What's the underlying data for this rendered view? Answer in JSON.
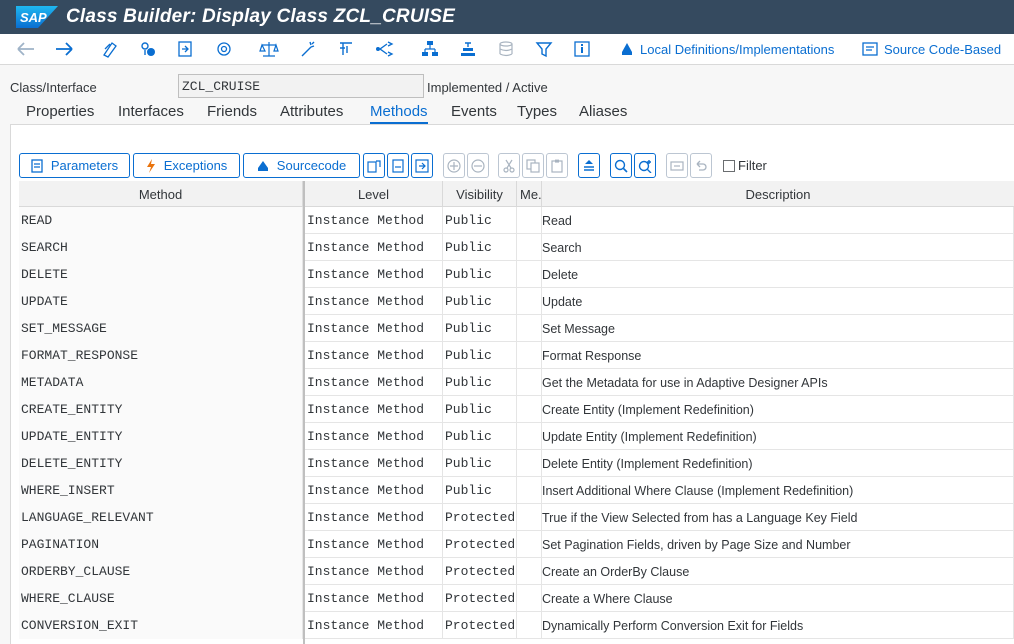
{
  "window": {
    "title": "Class Builder: Display Class ZCL_CRUISE",
    "logo": "SAP"
  },
  "toolbar": {
    "icons": [
      "back-icon",
      "forward-icon",
      "change-display-icon",
      "active-inactive-icon",
      "other-object-icon",
      "where-used-icon",
      "check-icon",
      "activate-icon",
      "test-icon",
      "outline-icon",
      "navigate-icon",
      "hierarchy-icon",
      "pattern-icon",
      "enhance-icon",
      "filter-icon",
      "info-icon"
    ],
    "local_defs_label": "Local Definitions/Implementations",
    "source_code_label": "Source Code-Based"
  },
  "header": {
    "class_label": "Class/Interface",
    "class_value": "ZCL_CRUISE",
    "status": "Implemented / Active"
  },
  "tabs": [
    "Properties",
    "Interfaces",
    "Friends",
    "Attributes",
    "Methods",
    "Events",
    "Types",
    "Aliases"
  ],
  "active_tab": "Methods",
  "method_toolbar": {
    "parameters_label": "Parameters",
    "exceptions_label": "Exceptions",
    "sourcecode_label": "Sourcecode",
    "filter_label": "Filter"
  },
  "grid": {
    "columns": [
      "Method",
      "Level",
      "Visibility",
      "Me.",
      "Description"
    ],
    "rows": [
      {
        "method": "READ",
        "level": "Instance Method",
        "visibility": "Public",
        "me": "",
        "description": "Read"
      },
      {
        "method": "SEARCH",
        "level": "Instance Method",
        "visibility": "Public",
        "me": "",
        "description": "Search"
      },
      {
        "method": "DELETE",
        "level": "Instance Method",
        "visibility": "Public",
        "me": "",
        "description": "Delete"
      },
      {
        "method": "UPDATE",
        "level": "Instance Method",
        "visibility": "Public",
        "me": "",
        "description": "Update"
      },
      {
        "method": "SET_MESSAGE",
        "level": "Instance Method",
        "visibility": "Public",
        "me": "",
        "description": "Set Message"
      },
      {
        "method": "FORMAT_RESPONSE",
        "level": "Instance Method",
        "visibility": "Public",
        "me": "",
        "description": "Format Response"
      },
      {
        "method": "METADATA",
        "level": "Instance Method",
        "visibility": "Public",
        "me": "",
        "description": "Get the Metadata for use in Adaptive Designer APIs"
      },
      {
        "method": "CREATE_ENTITY",
        "level": "Instance Method",
        "visibility": "Public",
        "me": "",
        "description": "Create Entity (Implement Redefinition)"
      },
      {
        "method": "UPDATE_ENTITY",
        "level": "Instance Method",
        "visibility": "Public",
        "me": "",
        "description": "Update Entity (Implement Redefinition)"
      },
      {
        "method": "DELETE_ENTITY",
        "level": "Instance Method",
        "visibility": "Public",
        "me": "",
        "description": "Delete Entity (Implement Redefinition)"
      },
      {
        "method": "WHERE_INSERT",
        "level": "Instance Method",
        "visibility": "Public",
        "me": "",
        "description": "Insert Additional Where Clause (Implement Redefinition)"
      },
      {
        "method": "LANGUAGE_RELEVANT",
        "level": "Instance Method",
        "visibility": "Protected",
        "me": "",
        "description": "True if the View Selected from has a Language Key Field"
      },
      {
        "method": "PAGINATION",
        "level": "Instance Method",
        "visibility": "Protected",
        "me": "",
        "description": "Set Pagination Fields, driven by Page Size and Number"
      },
      {
        "method": "ORDERBY_CLAUSE",
        "level": "Instance Method",
        "visibility": "Protected",
        "me": "",
        "description": "Create an OrderBy Clause"
      },
      {
        "method": "WHERE_CLAUSE",
        "level": "Instance Method",
        "visibility": "Protected",
        "me": "",
        "description": "Create a Where Clause"
      },
      {
        "method": "CONVERSION_EXIT",
        "level": "Instance Method",
        "visibility": "Protected",
        "me": "",
        "description": "Dynamically Perform Conversion Exit for Fields"
      }
    ]
  },
  "colors": {
    "titlebar": "#354a5f",
    "accent": "#0a6ed1"
  }
}
